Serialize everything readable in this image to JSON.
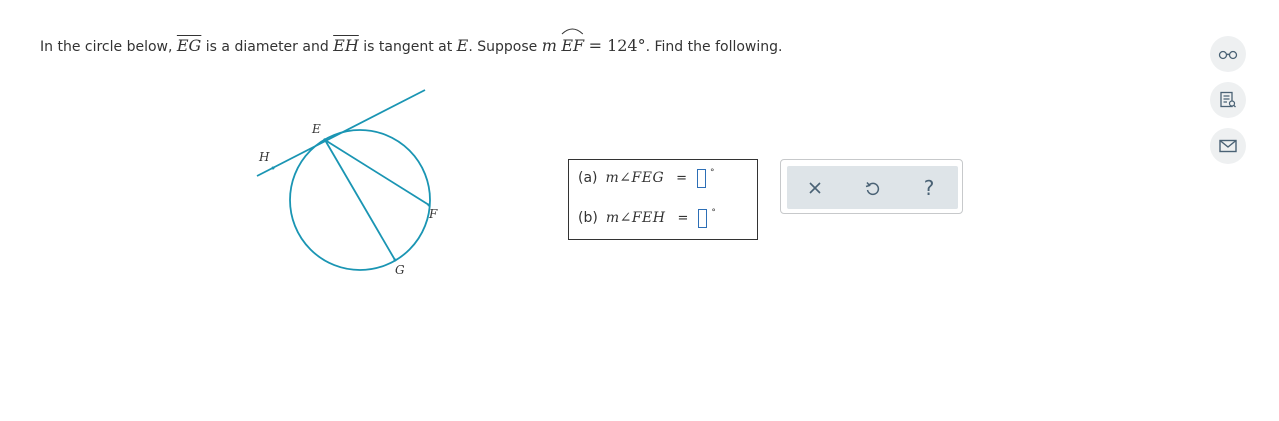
{
  "problem": {
    "p1": "In the circle below, ",
    "seg1": "EG",
    "p2": " is a diameter and ",
    "seg2": "EH",
    "p3": " is tangent at ",
    "pt": "E",
    "p4": ". Suppose ",
    "m": "m",
    "arc": "EF",
    "eq_value": "= 124°",
    "p5": ". Find the following."
  },
  "figure": {
    "labels": {
      "E": "E",
      "H": "H",
      "F": "F",
      "G": "G"
    },
    "colors": {
      "stroke": "#1a95b3"
    }
  },
  "answers": [
    {
      "label": "(a)",
      "expr": "m∠FEG",
      "eq": "=",
      "value": "",
      "unit": "°"
    },
    {
      "label": "(b)",
      "expr": "m∠FEH",
      "eq": "=",
      "value": "",
      "unit": "°"
    }
  ],
  "tools": {
    "clear": "clear-icon",
    "undo": "undo-icon",
    "help": "?"
  },
  "sidebar": {
    "items": [
      "glasses-icon",
      "notes-icon",
      "mail-icon"
    ]
  },
  "colors": {
    "accent": "#1a95b3",
    "tool_bg": "#dee4e8",
    "icon": "#4a6275",
    "input_border": "#2d6fb6"
  }
}
